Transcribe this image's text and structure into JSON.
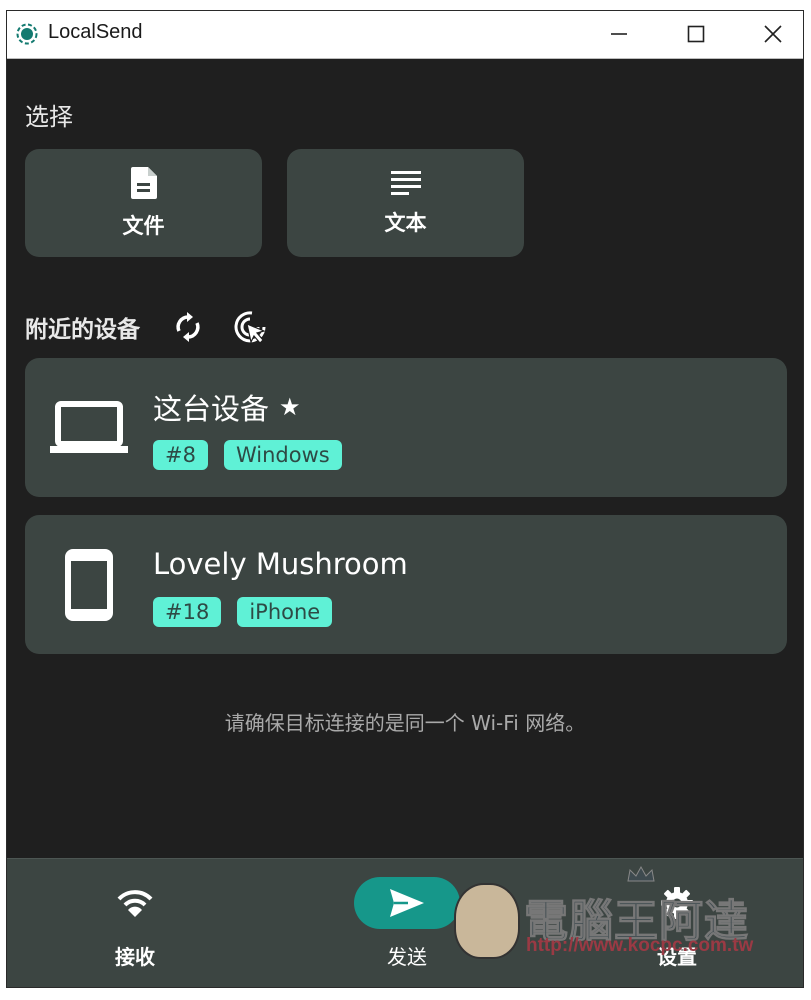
{
  "window": {
    "title": "LocalSend",
    "controls": {
      "minimize": "minimize",
      "maximize": "maximize",
      "close": "close"
    }
  },
  "select": {
    "title": "选择",
    "buttons": [
      {
        "label": "文件",
        "icon": "file-icon"
      },
      {
        "label": "文本",
        "icon": "text-lines-icon"
      }
    ]
  },
  "nearby": {
    "title": "附近的设备",
    "actions": [
      {
        "icon": "refresh-icon"
      },
      {
        "icon": "target-cursor-icon"
      }
    ],
    "devices": [
      {
        "name": "这台设备",
        "star": "★",
        "icon": "laptop-icon",
        "tags": [
          "#8",
          "Windows"
        ]
      },
      {
        "name": "Lovely Mushroom",
        "star": "",
        "icon": "phone-icon",
        "tags": [
          "#18",
          "iPhone"
        ]
      }
    ]
  },
  "hint": "请确保目标连接的是同一个 Wi-Fi 网络。",
  "bottom_nav": {
    "items": [
      {
        "label": "接收",
        "icon": "wifi-icon",
        "active": false
      },
      {
        "label": "发送",
        "icon": "send-icon",
        "active": true
      },
      {
        "label": "设置",
        "icon": "gear-icon",
        "active": false
      }
    ]
  },
  "watermark": {
    "title": "電腦王阿達",
    "url": "http://www.kocpc.com.tw"
  },
  "colors": {
    "accent": "#16978a",
    "tag_bg": "#5ff1d6",
    "card_bg": "#3c4542",
    "background": "#1f1f1f"
  }
}
